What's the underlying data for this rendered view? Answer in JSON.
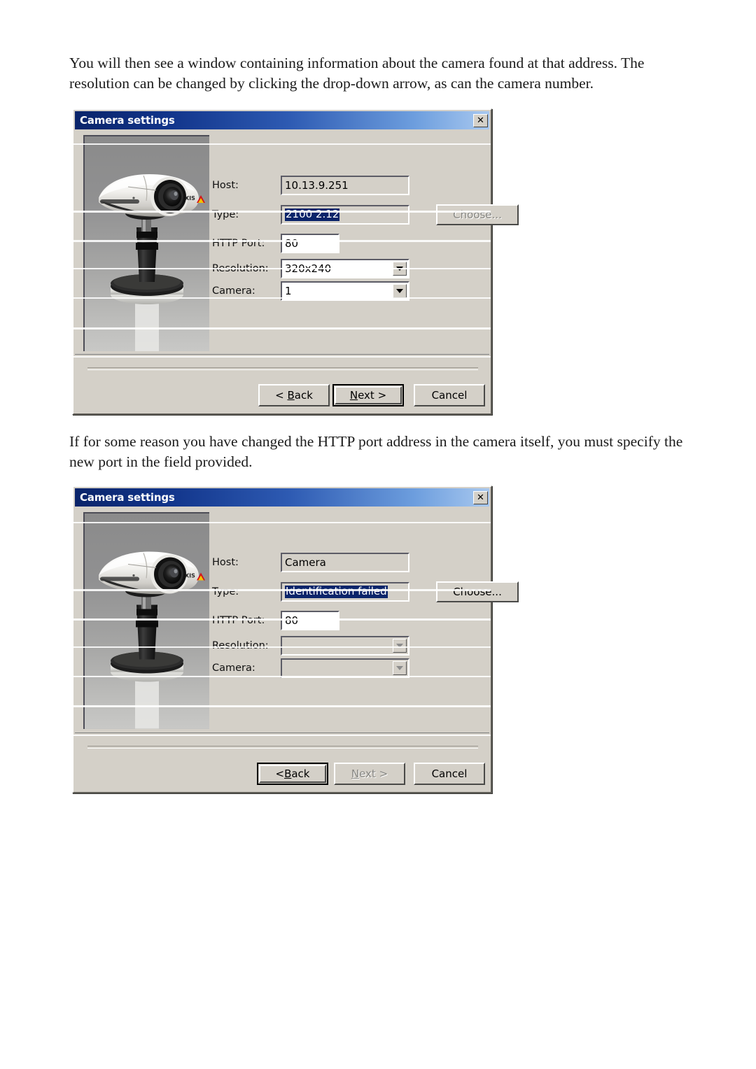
{
  "document": {
    "paragraph_1": "You will then see a window containing information about the camera found at that address. The resolution can be changed by clicking the drop-down arrow, as can the camera number.",
    "paragraph_2": "If for some reason you have changed the HTTP port address in the camera itself, you must specify the new port in the field provided."
  },
  "colors": {
    "titlebar_start": "#0a246a",
    "titlebar_end": "#a8c8ef",
    "dialog_face": "#d4d0c8",
    "selection": "#0a246a",
    "disabled_text": "#868682"
  },
  "dialog_1": {
    "title": "Camera settings",
    "close_label": "✕",
    "labels": {
      "host": "Host:",
      "type": "Type:",
      "http_port": "HTTP Port:",
      "resolution": "Resolution:",
      "camera": "Camera:"
    },
    "values": {
      "host": "10.13.9.251",
      "type": "2100 2.12",
      "http_port": "80",
      "resolution": "320x240",
      "camera": "1"
    },
    "choose_label": "Choose...",
    "buttons": {
      "back": "< Back",
      "next": "Next >",
      "cancel": "Cancel"
    }
  },
  "dialog_2": {
    "title": "Camera settings",
    "close_label": "✕",
    "labels": {
      "host": "Host:",
      "type": "Type:",
      "http_port": "HTTP Port:",
      "resolution": "Resolution:",
      "camera": "Camera:"
    },
    "values": {
      "host": "Camera",
      "type": "Identification failed",
      "http_port": "80",
      "resolution": "",
      "camera": ""
    },
    "choose_label": "Choose...",
    "buttons": {
      "back": "< Back",
      "next": "Next >",
      "cancel": "Cancel"
    }
  }
}
